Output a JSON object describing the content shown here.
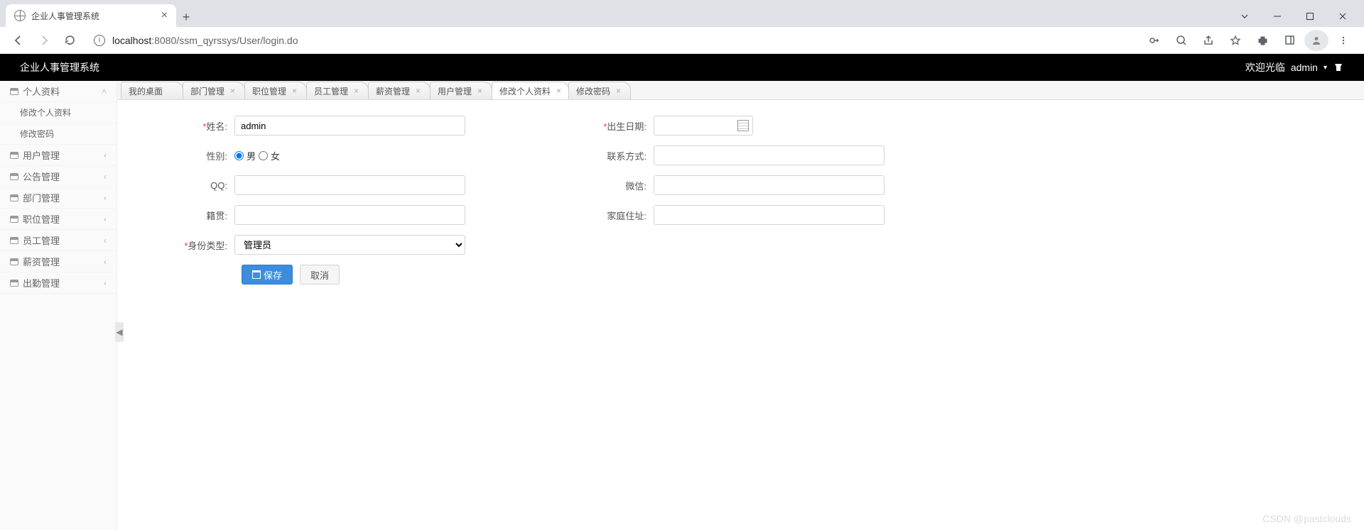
{
  "browser": {
    "tab_title": "企业人事管理系统",
    "url_host": "localhost",
    "url_port": ":8080",
    "url_path": "/ssm_qyrssys/User/login.do"
  },
  "header": {
    "app_title": "企业人事管理系统",
    "welcome": "欢迎光临",
    "user": "admin"
  },
  "sidebar": {
    "items": [
      {
        "label": "个人资料",
        "expanded": true
      },
      {
        "label": "修改个人资料",
        "sub": true
      },
      {
        "label": "修改密码",
        "sub": true
      },
      {
        "label": "用户管理"
      },
      {
        "label": "公告管理"
      },
      {
        "label": "部门管理"
      },
      {
        "label": "职位管理"
      },
      {
        "label": "员工管理"
      },
      {
        "label": "薪资管理"
      },
      {
        "label": "出勤管理"
      }
    ]
  },
  "tabs": [
    {
      "label": "我的桌面",
      "closable": false
    },
    {
      "label": "部门管理",
      "closable": true
    },
    {
      "label": "职位管理",
      "closable": true
    },
    {
      "label": "员工管理",
      "closable": true
    },
    {
      "label": "薪资管理",
      "closable": true
    },
    {
      "label": "用户管理",
      "closable": true
    },
    {
      "label": "修改个人资料",
      "closable": true,
      "active": true
    },
    {
      "label": "修改密码",
      "closable": true
    }
  ],
  "form": {
    "name_label": "姓名:",
    "name_value": "admin",
    "sex_label": "性别:",
    "sex_male": "男",
    "sex_female": "女",
    "qq_label": "QQ:",
    "native_label": "籍贯:",
    "idtype_label": "身份类型:",
    "idtype_value": "管理员",
    "birth_label": "出生日期:",
    "contact_label": "联系方式:",
    "wechat_label": "微信:",
    "addr_label": "家庭住址:",
    "save": "保存",
    "cancel": "取消"
  },
  "watermark": "CSDN @pastclouds"
}
